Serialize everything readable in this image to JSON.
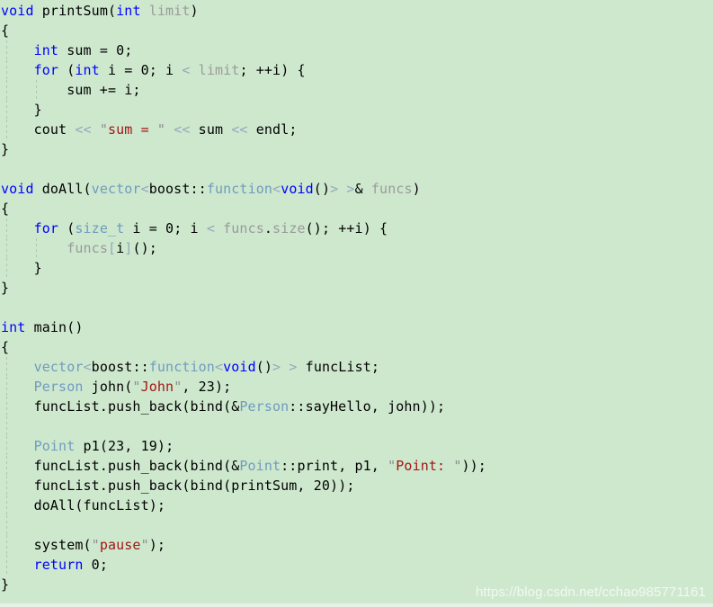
{
  "editor": {
    "language": "C++",
    "background_color": "#cee8ce",
    "indent_guide_color": "#96aa96",
    "font_size_px": 15,
    "line_height_px": 22,
    "tab_width": 4
  },
  "palette": {
    "keyword": "#0000ff",
    "plain": "#000000",
    "type": "#6f9bbf",
    "variable": "#9a9a9a",
    "string": "#a31515",
    "quote": "#8d8d8d",
    "operator": "#93a9bb",
    "number": "#000000",
    "watermark": "#ffffff"
  },
  "watermark": {
    "text": "https://blog.csdn.net/cchao985771161"
  },
  "code": {
    "lines": [
      {
        "guides": [],
        "tokens": [
          {
            "t": "void",
            "c": "kw"
          },
          {
            "t": " ",
            "c": "plain"
          },
          {
            "t": "printSum",
            "c": "plain"
          },
          {
            "t": "(",
            "c": "plain"
          },
          {
            "t": "int",
            "c": "kw"
          },
          {
            "t": " ",
            "c": "plain"
          },
          {
            "t": "limit",
            "c": "var"
          },
          {
            "t": ")",
            "c": "plain"
          }
        ]
      },
      {
        "guides": [],
        "tokens": [
          {
            "t": "{",
            "c": "plain"
          }
        ]
      },
      {
        "guides": [
          "g1"
        ],
        "tokens": [
          {
            "t": "    ",
            "c": "plain"
          },
          {
            "t": "int",
            "c": "kw"
          },
          {
            "t": " sum ",
            "c": "plain"
          },
          {
            "t": "=",
            "c": "plain"
          },
          {
            "t": " ",
            "c": "plain"
          },
          {
            "t": "0",
            "c": "num"
          },
          {
            "t": ";",
            "c": "plain"
          }
        ]
      },
      {
        "guides": [
          "g1"
        ],
        "tokens": [
          {
            "t": "    ",
            "c": "plain"
          },
          {
            "t": "for",
            "c": "kw"
          },
          {
            "t": " (",
            "c": "plain"
          },
          {
            "t": "int",
            "c": "kw"
          },
          {
            "t": " i ",
            "c": "plain"
          },
          {
            "t": "=",
            "c": "plain"
          },
          {
            "t": " ",
            "c": "plain"
          },
          {
            "t": "0",
            "c": "num"
          },
          {
            "t": "; i ",
            "c": "plain"
          },
          {
            "t": "<",
            "c": "op"
          },
          {
            "t": " ",
            "c": "plain"
          },
          {
            "t": "limit",
            "c": "var"
          },
          {
            "t": "; ++i) {",
            "c": "plain"
          }
        ]
      },
      {
        "guides": [
          "g1",
          "g2"
        ],
        "tokens": [
          {
            "t": "        sum += i;",
            "c": "plain"
          }
        ]
      },
      {
        "guides": [
          "g1"
        ],
        "tokens": [
          {
            "t": "    }",
            "c": "plain"
          }
        ]
      },
      {
        "guides": [
          "g1"
        ],
        "tokens": [
          {
            "t": "    cout ",
            "c": "plain"
          },
          {
            "t": "<<",
            "c": "op"
          },
          {
            "t": " ",
            "c": "plain"
          },
          {
            "t": "\"",
            "c": "quote"
          },
          {
            "t": "sum = ",
            "c": "str"
          },
          {
            "t": "\"",
            "c": "quote"
          },
          {
            "t": " ",
            "c": "plain"
          },
          {
            "t": "<<",
            "c": "op"
          },
          {
            "t": " sum ",
            "c": "plain"
          },
          {
            "t": "<<",
            "c": "op"
          },
          {
            "t": " endl;",
            "c": "plain"
          }
        ]
      },
      {
        "guides": [],
        "tokens": [
          {
            "t": "}",
            "c": "plain"
          }
        ]
      },
      {
        "guides": [],
        "tokens": []
      },
      {
        "guides": [],
        "tokens": [
          {
            "t": "void",
            "c": "kw"
          },
          {
            "t": " doAll(",
            "c": "plain"
          },
          {
            "t": "vector",
            "c": "type"
          },
          {
            "t": "<",
            "c": "op"
          },
          {
            "t": "boost",
            "c": "plain"
          },
          {
            "t": "::",
            "c": "plain"
          },
          {
            "t": "function",
            "c": "type"
          },
          {
            "t": "<",
            "c": "op"
          },
          {
            "t": "void",
            "c": "kw"
          },
          {
            "t": "()",
            "c": "plain"
          },
          {
            "t": ">",
            "c": "op"
          },
          {
            "t": " ",
            "c": "plain"
          },
          {
            "t": ">",
            "c": "op"
          },
          {
            "t": "& ",
            "c": "plain"
          },
          {
            "t": "funcs",
            "c": "var"
          },
          {
            "t": ")",
            "c": "plain"
          }
        ]
      },
      {
        "guides": [],
        "tokens": [
          {
            "t": "{",
            "c": "plain"
          }
        ]
      },
      {
        "guides": [
          "g1"
        ],
        "tokens": [
          {
            "t": "    ",
            "c": "plain"
          },
          {
            "t": "for",
            "c": "kw"
          },
          {
            "t": " (",
            "c": "plain"
          },
          {
            "t": "size_t",
            "c": "type"
          },
          {
            "t": " i ",
            "c": "plain"
          },
          {
            "t": "=",
            "c": "plain"
          },
          {
            "t": " ",
            "c": "plain"
          },
          {
            "t": "0",
            "c": "num"
          },
          {
            "t": "; i ",
            "c": "plain"
          },
          {
            "t": "<",
            "c": "op"
          },
          {
            "t": " ",
            "c": "plain"
          },
          {
            "t": "funcs",
            "c": "var"
          },
          {
            "t": ".",
            "c": "plain"
          },
          {
            "t": "size",
            "c": "var"
          },
          {
            "t": "(); ++i) {",
            "c": "plain"
          }
        ]
      },
      {
        "guides": [
          "g1",
          "g2"
        ],
        "tokens": [
          {
            "t": "        ",
            "c": "plain"
          },
          {
            "t": "funcs",
            "c": "var"
          },
          {
            "t": "[",
            "c": "op"
          },
          {
            "t": "i",
            "c": "plain"
          },
          {
            "t": "]",
            "c": "op"
          },
          {
            "t": "()",
            "c": "plain"
          },
          {
            "t": ";",
            "c": "plain"
          }
        ]
      },
      {
        "guides": [
          "g1"
        ],
        "tokens": [
          {
            "t": "    }",
            "c": "plain"
          }
        ]
      },
      {
        "guides": [],
        "tokens": [
          {
            "t": "}",
            "c": "plain"
          }
        ]
      },
      {
        "guides": [],
        "tokens": []
      },
      {
        "guides": [],
        "tokens": [
          {
            "t": "int",
            "c": "kw"
          },
          {
            "t": " main()",
            "c": "plain"
          }
        ]
      },
      {
        "guides": [],
        "tokens": [
          {
            "t": "{",
            "c": "plain"
          }
        ]
      },
      {
        "guides": [
          "g1"
        ],
        "tokens": [
          {
            "t": "    ",
            "c": "plain"
          },
          {
            "t": "vector",
            "c": "type"
          },
          {
            "t": "<",
            "c": "op"
          },
          {
            "t": "boost",
            "c": "plain"
          },
          {
            "t": "::",
            "c": "plain"
          },
          {
            "t": "function",
            "c": "type"
          },
          {
            "t": "<",
            "c": "op"
          },
          {
            "t": "void",
            "c": "kw"
          },
          {
            "t": "()",
            "c": "plain"
          },
          {
            "t": ">",
            "c": "op"
          },
          {
            "t": " ",
            "c": "plain"
          },
          {
            "t": ">",
            "c": "op"
          },
          {
            "t": " funcList;",
            "c": "plain"
          }
        ]
      },
      {
        "guides": [
          "g1"
        ],
        "tokens": [
          {
            "t": "    ",
            "c": "plain"
          },
          {
            "t": "Person",
            "c": "type"
          },
          {
            "t": " john(",
            "c": "plain"
          },
          {
            "t": "\"",
            "c": "quote"
          },
          {
            "t": "John",
            "c": "str"
          },
          {
            "t": "\"",
            "c": "quote"
          },
          {
            "t": ", ",
            "c": "plain"
          },
          {
            "t": "23",
            "c": "num"
          },
          {
            "t": ");",
            "c": "plain"
          }
        ]
      },
      {
        "guides": [
          "g1"
        ],
        "tokens": [
          {
            "t": "    funcList.push_back(bind(&",
            "c": "plain"
          },
          {
            "t": "Person",
            "c": "type"
          },
          {
            "t": "::sayHello, john));",
            "c": "plain"
          }
        ]
      },
      {
        "guides": [
          "g1"
        ],
        "tokens": []
      },
      {
        "guides": [
          "g1"
        ],
        "tokens": [
          {
            "t": "    ",
            "c": "plain"
          },
          {
            "t": "Point",
            "c": "type"
          },
          {
            "t": " p1(",
            "c": "plain"
          },
          {
            "t": "23",
            "c": "num"
          },
          {
            "t": ", ",
            "c": "plain"
          },
          {
            "t": "19",
            "c": "num"
          },
          {
            "t": ");",
            "c": "plain"
          }
        ]
      },
      {
        "guides": [
          "g1"
        ],
        "tokens": [
          {
            "t": "    funcList.push_back(bind(&",
            "c": "plain"
          },
          {
            "t": "Point",
            "c": "type"
          },
          {
            "t": "::print, p1, ",
            "c": "plain"
          },
          {
            "t": "\"",
            "c": "quote"
          },
          {
            "t": "Point: ",
            "c": "str"
          },
          {
            "t": "\"",
            "c": "quote"
          },
          {
            "t": "));",
            "c": "plain"
          }
        ]
      },
      {
        "guides": [
          "g1"
        ],
        "tokens": [
          {
            "t": "    funcList.push_back(bind(printSum, ",
            "c": "plain"
          },
          {
            "t": "20",
            "c": "num"
          },
          {
            "t": "));",
            "c": "plain"
          }
        ]
      },
      {
        "guides": [
          "g1"
        ],
        "tokens": [
          {
            "t": "    doAll(funcList);",
            "c": "plain"
          }
        ]
      },
      {
        "guides": [
          "g1"
        ],
        "tokens": []
      },
      {
        "guides": [
          "g1"
        ],
        "tokens": [
          {
            "t": "    system(",
            "c": "plain"
          },
          {
            "t": "\"",
            "c": "quote"
          },
          {
            "t": "pause",
            "c": "str"
          },
          {
            "t": "\"",
            "c": "quote"
          },
          {
            "t": ");",
            "c": "plain"
          }
        ]
      },
      {
        "guides": [
          "g1"
        ],
        "tokens": [
          {
            "t": "    ",
            "c": "plain"
          },
          {
            "t": "return",
            "c": "kw"
          },
          {
            "t": " ",
            "c": "plain"
          },
          {
            "t": "0",
            "c": "num"
          },
          {
            "t": ";",
            "c": "plain"
          }
        ]
      },
      {
        "guides": [],
        "tokens": [
          {
            "t": "}",
            "c": "plain"
          }
        ]
      }
    ]
  }
}
